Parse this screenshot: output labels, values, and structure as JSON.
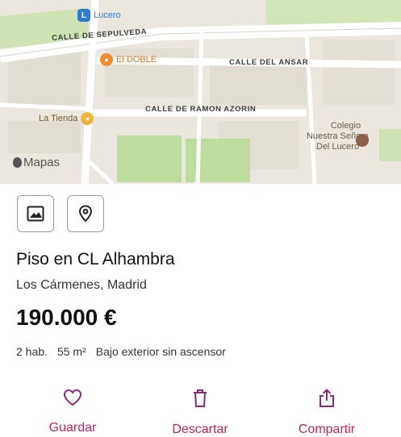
{
  "map": {
    "streets": {
      "sepulveda": "CALLE DE SEPULVEDA",
      "ansar": "CALLE DEL ANSAR",
      "ramon_azorin": "CALLE DE RAMON AZORIN"
    },
    "pois": {
      "lucero": "Lucero",
      "el_doble": "El DOBLE",
      "la_tienda": "La Tienda",
      "colegio_line1": "Colegio",
      "colegio_line2": "Nuestra Señora",
      "colegio_line3": "Del Lucero"
    },
    "attribution": "Mapas"
  },
  "listing": {
    "title": "Piso en CL Alhambra",
    "location": "Los Cármenes, Madrid",
    "price": "190.000 €",
    "features": [
      "2 hab.",
      "55 m²",
      "Bajo exterior sin ascensor"
    ]
  },
  "actions": {
    "save": "Guardar",
    "discard": "Descartar",
    "share": "Compartir"
  },
  "colors": {
    "accent": "#c0245e",
    "icon_accent": "#8e2a72"
  }
}
